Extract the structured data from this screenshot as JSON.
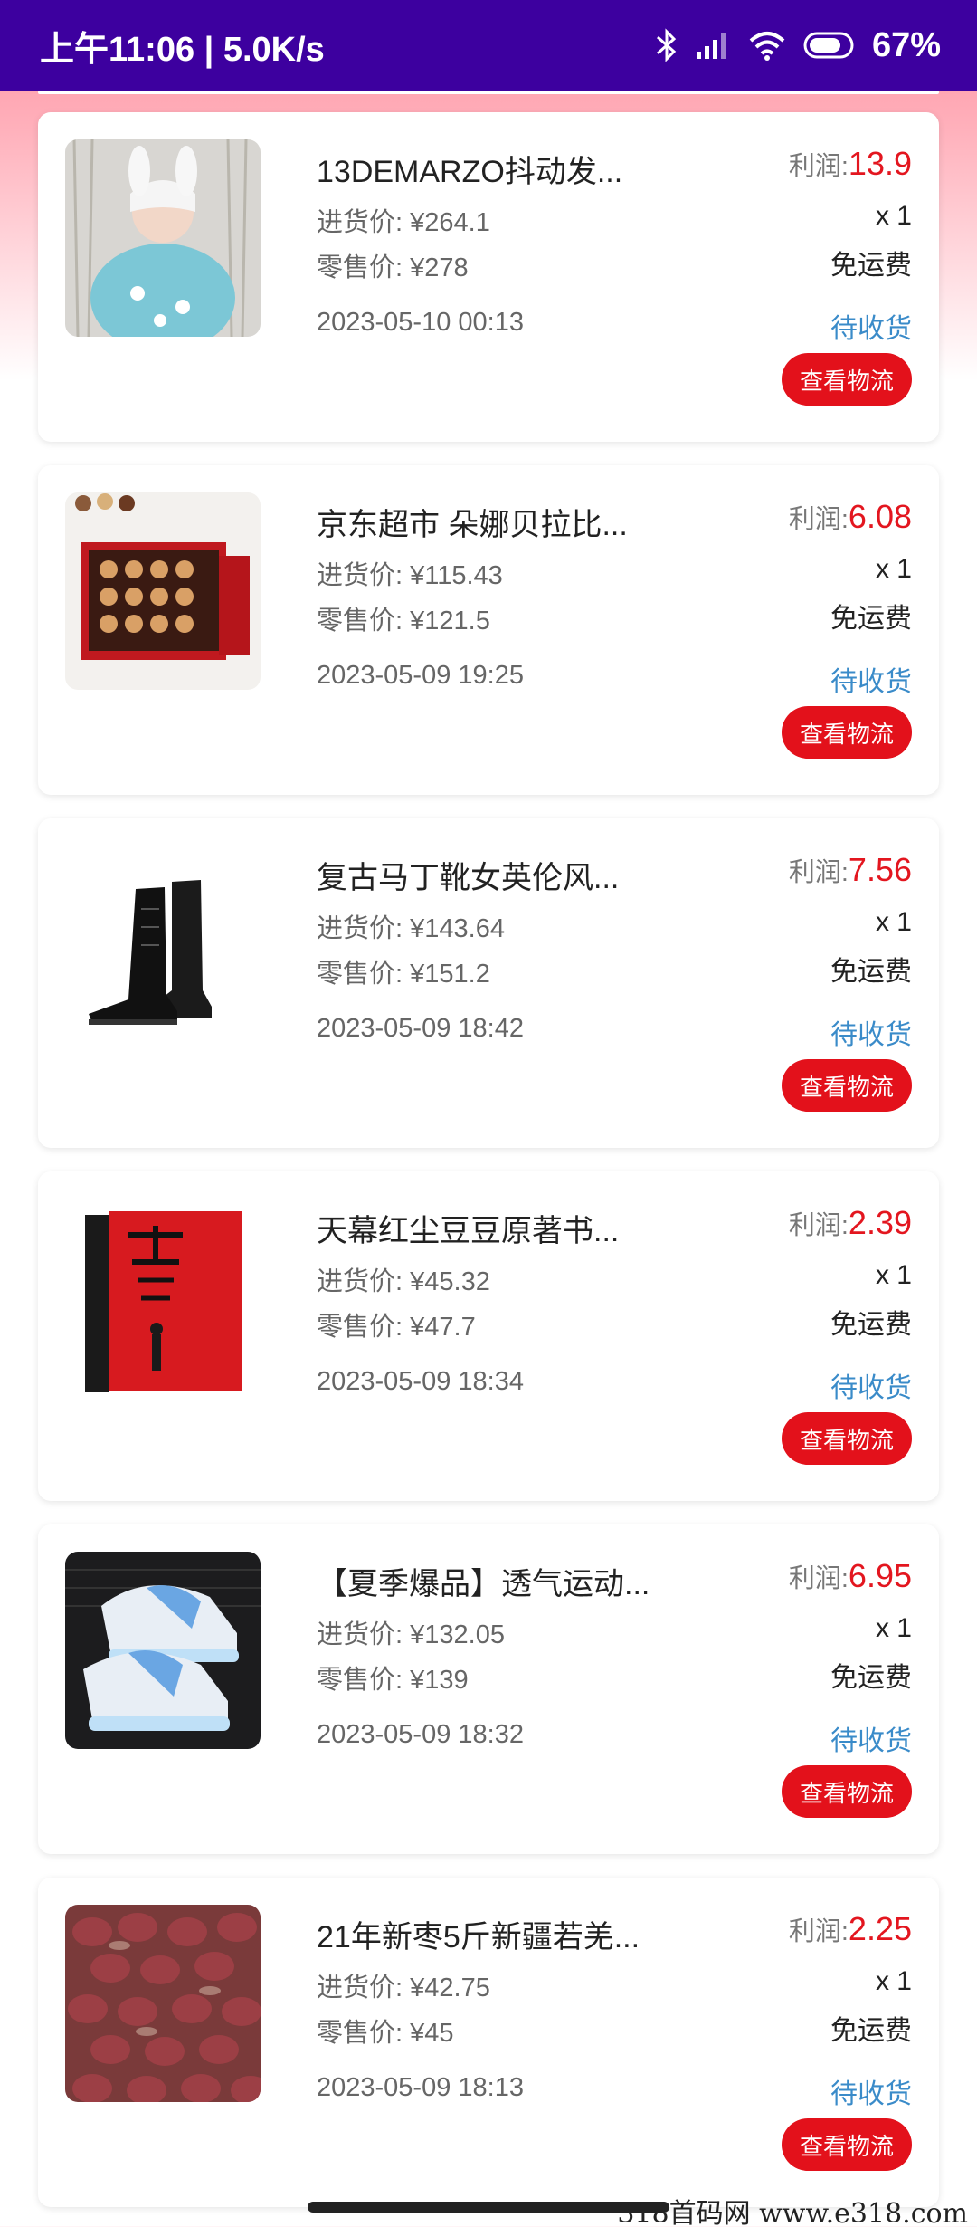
{
  "status_bar": {
    "time_speed": "上午11:06 | 5.0K/s",
    "battery": "67%"
  },
  "labels": {
    "profit": "利润:",
    "cost_prefix": "进货价: ¥",
    "retail_prefix": "零售价: ¥",
    "shipping": "免运费",
    "logistics_button": "查看物流"
  },
  "orders": [
    {
      "title": "13DEMARZO抖动发...",
      "profit": "13.9",
      "cost": "264.1",
      "retail": "278",
      "date": "2023-05-10 00:13",
      "qty": "x 1",
      "status": "待收货"
    },
    {
      "title": "京东超市 朵娜贝拉比...",
      "profit": "6.08",
      "cost": "115.43",
      "retail": "121.5",
      "date": "2023-05-09 19:25",
      "qty": "x 1",
      "status": "待收货"
    },
    {
      "title": "复古马丁靴女英伦风...",
      "profit": "7.56",
      "cost": "143.64",
      "retail": "151.2",
      "date": "2023-05-09 18:42",
      "qty": "x 1",
      "status": "待收货"
    },
    {
      "title": "天幕红尘豆豆原著书...",
      "profit": "2.39",
      "cost": "45.32",
      "retail": "47.7",
      "date": "2023-05-09 18:34",
      "qty": "x 1",
      "status": "待收货"
    },
    {
      "title": "【夏季爆品】透气运动...",
      "profit": "6.95",
      "cost": "132.05",
      "retail": "139",
      "date": "2023-05-09 18:32",
      "qty": "x 1",
      "status": "待收货"
    },
    {
      "title": "21年新枣5斤新疆若羌...",
      "profit": "2.25",
      "cost": "42.75",
      "retail": "45",
      "date": "2023-05-09 18:13",
      "qty": "x 1",
      "status": "待收货"
    }
  ],
  "watermark": "318首码网  www.e318.com"
}
